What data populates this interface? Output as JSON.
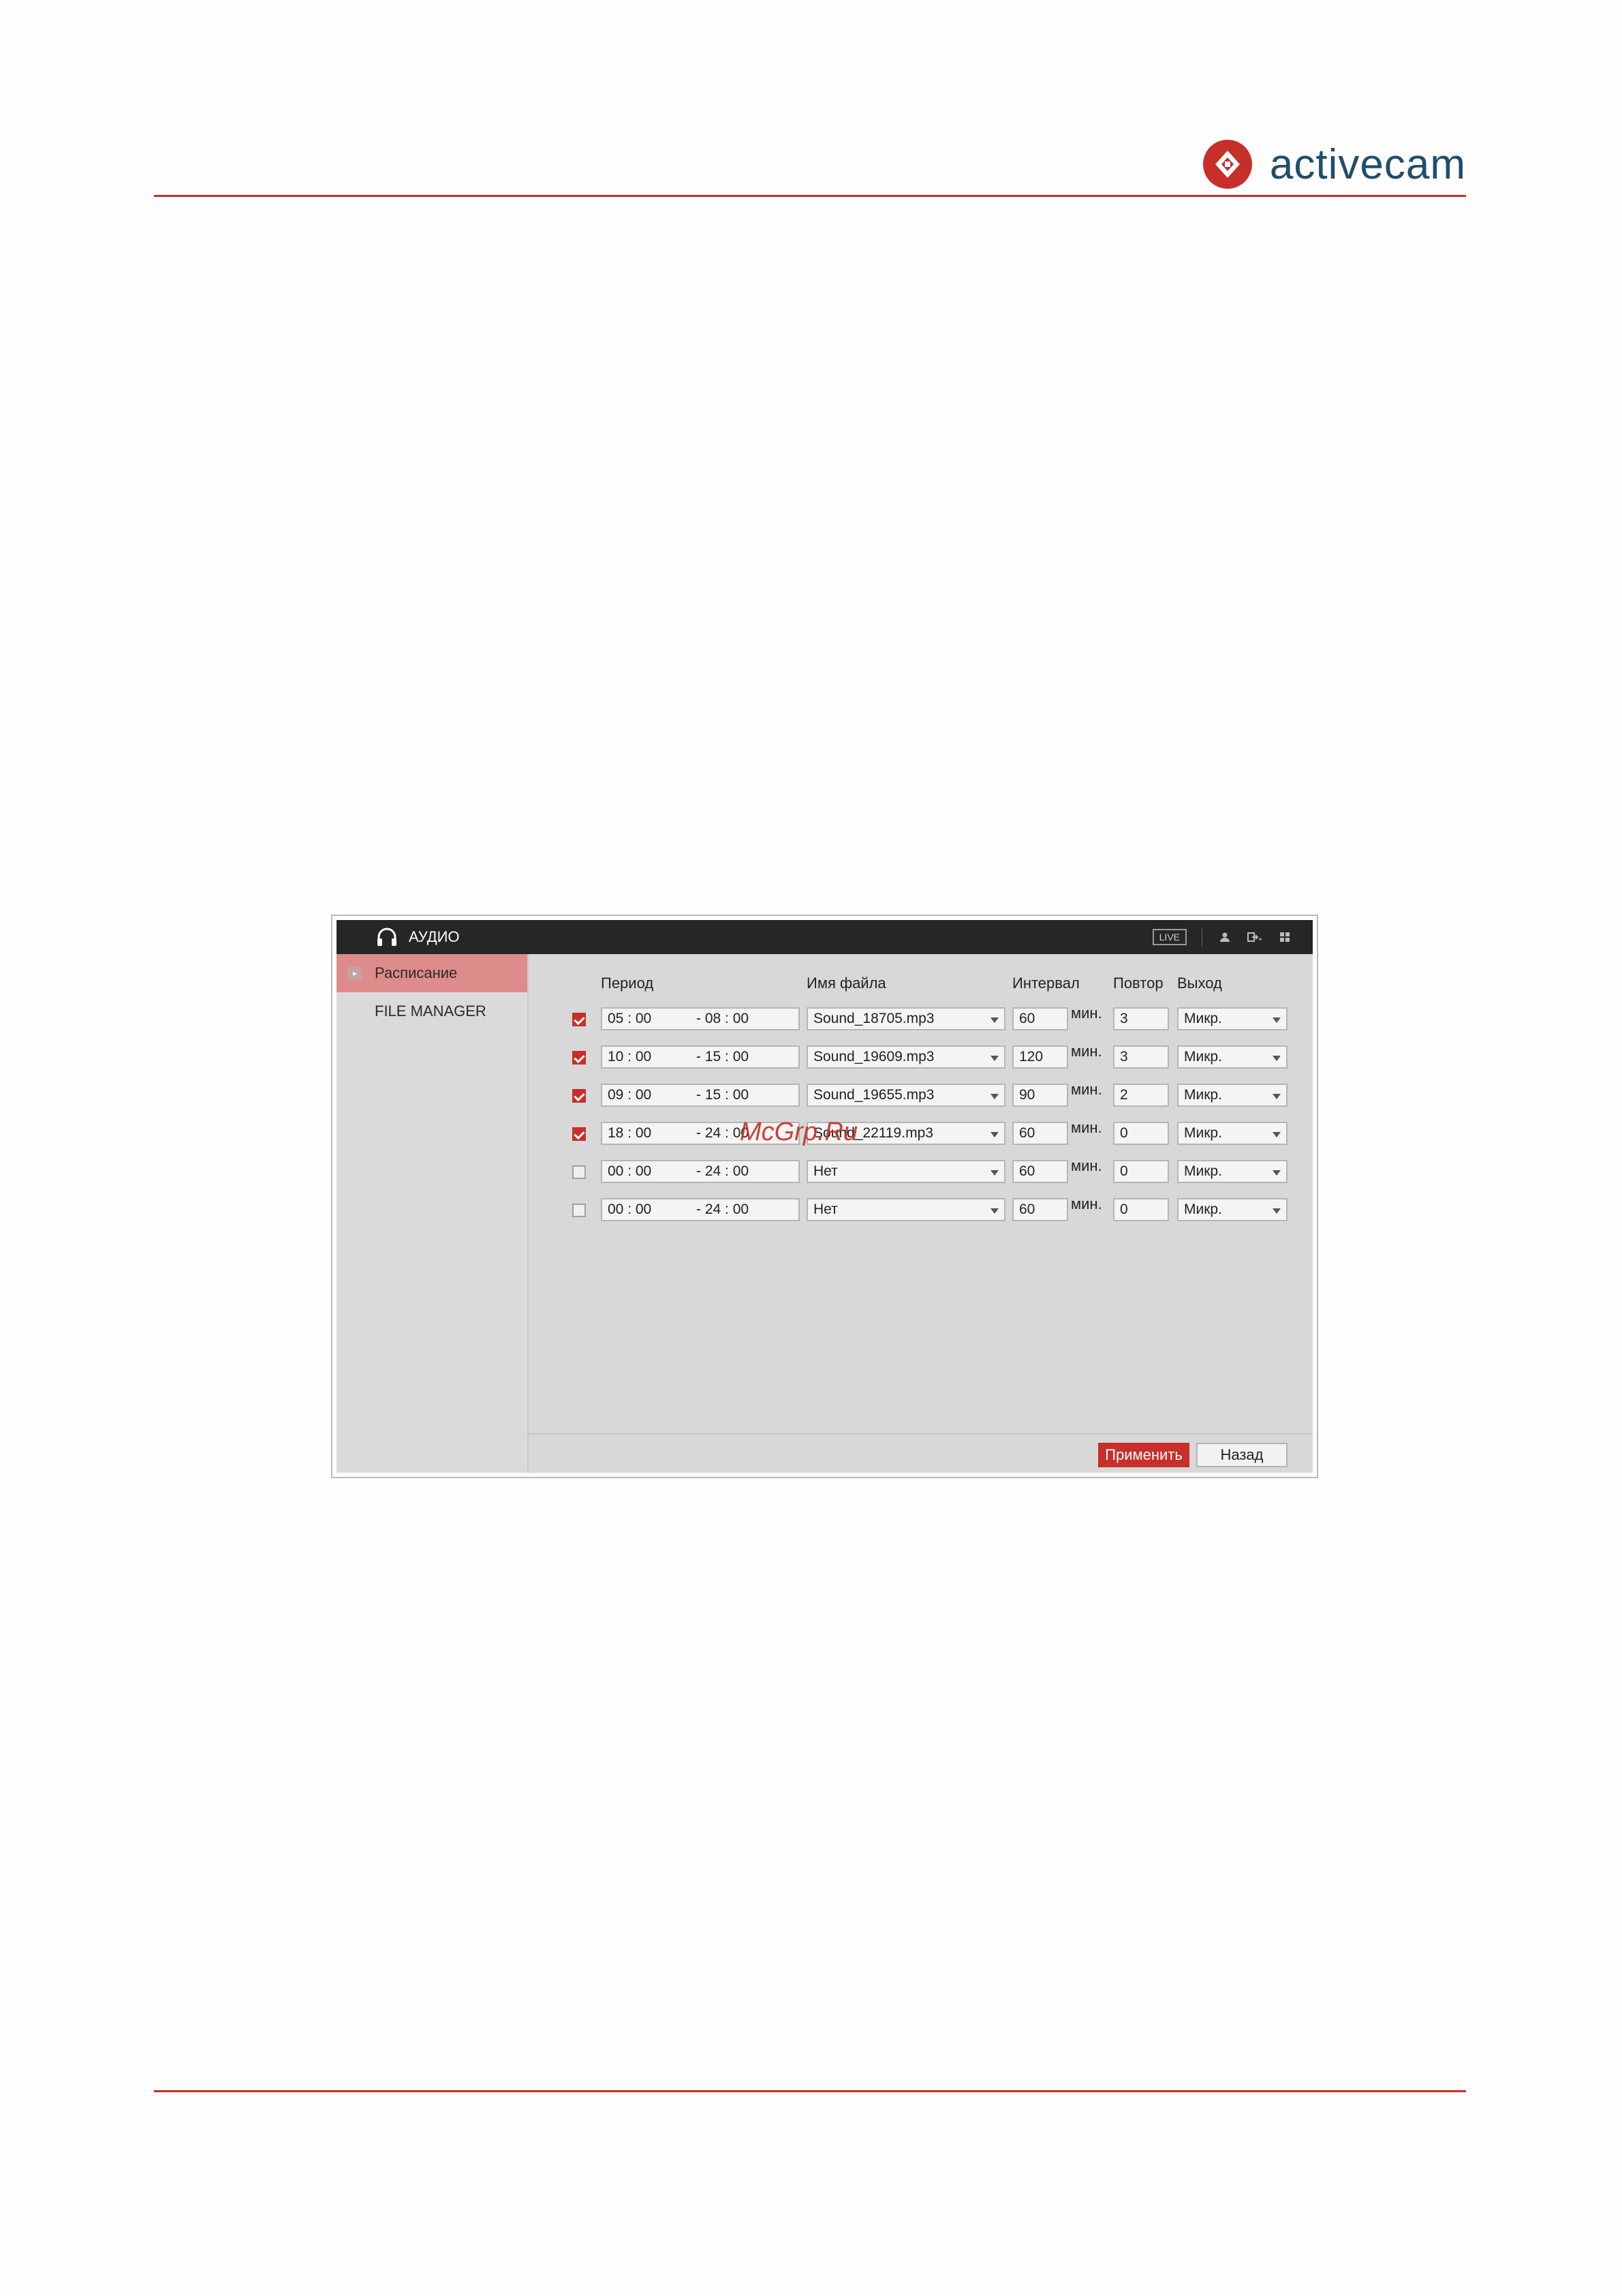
{
  "logo": {
    "text": "activecam"
  },
  "window": {
    "title": "АУДИО",
    "live": "LIVE",
    "icons": [
      "headphones-icon",
      "user-icon",
      "logout-icon",
      "grid-icon"
    ]
  },
  "sidebar": {
    "items": [
      {
        "label": "Расписание",
        "active": true
      },
      {
        "label": "FILE MANAGER",
        "active": false
      }
    ]
  },
  "table": {
    "headers": {
      "period": "Период",
      "file": "Имя файла",
      "interval": "Интервал",
      "repeat": "Повтор",
      "output": "Выход"
    },
    "unit": "мин.",
    "rows": [
      {
        "enabled": true,
        "start": "05 : 00",
        "end": "- 08 : 00",
        "file": "Sound_18705.mp3",
        "interval": "60",
        "repeat": "3",
        "output": "Микр."
      },
      {
        "enabled": true,
        "start": "10 : 00",
        "end": "- 15 : 00",
        "file": "Sound_19609.mp3",
        "interval": "120",
        "repeat": "3",
        "output": "Микр."
      },
      {
        "enabled": true,
        "start": "09 : 00",
        "end": "- 15 : 00",
        "file": "Sound_19655.mp3",
        "interval": "90",
        "repeat": "2",
        "output": "Микр."
      },
      {
        "enabled": true,
        "start": "18 : 00",
        "end": "- 24 : 00",
        "file": "Sound_22119.mp3",
        "interval": "60",
        "repeat": "0",
        "output": "Микр."
      },
      {
        "enabled": false,
        "start": "00 : 00",
        "end": "- 24 : 00",
        "file": "Нет",
        "interval": "60",
        "repeat": "0",
        "output": "Микр."
      },
      {
        "enabled": false,
        "start": "00 : 00",
        "end": "- 24 : 00",
        "file": "Нет",
        "interval": "60",
        "repeat": "0",
        "output": "Микр."
      }
    ]
  },
  "buttons": {
    "apply": "Применить",
    "back": "Назад"
  },
  "watermark": "McGrp.Ru",
  "colors": {
    "accent": "#c62f2a",
    "brand_text": "#1f4e6b"
  }
}
